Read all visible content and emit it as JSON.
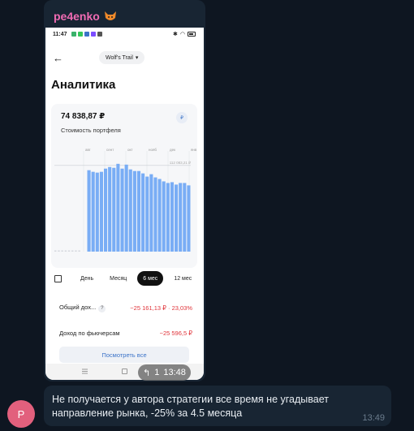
{
  "message1": {
    "sender": "pe4enko",
    "sender_emoji": "🦊",
    "time": "13:48",
    "reply_count": "1",
    "screenshot": {
      "status_time": "11:47",
      "strategy": "Wolf's Trail",
      "title": "Аналитика",
      "portfolio_value": "74 838,87 ₽",
      "portfolio_label": "Стоимость портфеля",
      "currency_badge": "₽",
      "chart_marker": "112 083,21 ₽",
      "months": [
        "авг",
        "сент",
        "окт",
        "нояб",
        "дек",
        "янв"
      ],
      "periods": [
        "День",
        "Месяц",
        "6 мес",
        "12 мес"
      ],
      "active_period": "6 мес",
      "total_income_label": "Общий дох...",
      "total_income_value": "−25 161,13 ₽ · 23,03%",
      "futures_label": "Доход по фьючерсам",
      "futures_value": "−25 596,5 ₽",
      "see_all": "Посмотреть все"
    }
  },
  "message2": {
    "avatar_letter": "P",
    "text": "Не получается у автора стратегии все время не угадывает направление рынка, -25% за 4.5 месяца",
    "time": "13:49"
  },
  "chart_data": {
    "type": "bar",
    "title": "",
    "xlabel": "",
    "ylabel": "",
    "categories": [
      "авг",
      "сент",
      "окт",
      "нояб",
      "дек",
      "янв"
    ],
    "values": [
      102,
      100,
      99,
      100,
      104,
      106,
      105,
      110,
      104,
      109,
      103,
      101,
      101,
      98,
      94,
      97,
      93,
      91,
      88,
      86,
      87,
      84,
      86,
      86,
      83
    ],
    "reference_line": 112083.21,
    "ylim": [
      0,
      120
    ]
  },
  "colors": {
    "bar": "#79adf5",
    "negative": "#e0343a",
    "link": "#3b73c8",
    "sender": "#f06bb3",
    "avatar": "#e2607d"
  }
}
